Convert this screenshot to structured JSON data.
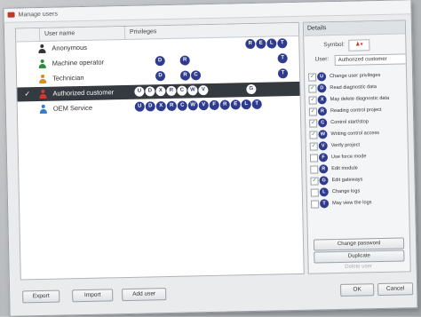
{
  "window": {
    "title": "Manage users"
  },
  "grid": {
    "header": {
      "user_name": "User name",
      "privileges": "Privileges"
    },
    "rows": [
      {
        "name": "Anonymous",
        "icon": "user-black-icon",
        "checked": false,
        "selected": false,
        "privileges": [
          "R",
          "E",
          "L",
          "T"
        ]
      },
      {
        "name": "Machine operator",
        "icon": "user-green-icon",
        "checked": false,
        "selected": false,
        "privileges": [
          "D",
          "R",
          "T"
        ]
      },
      {
        "name": "Technician",
        "icon": "user-orange-icon",
        "checked": false,
        "selected": false,
        "privileges": [
          "D",
          "R",
          "C",
          "T"
        ]
      },
      {
        "name": "Authorized customer",
        "icon": "user-red-icon",
        "checked": true,
        "selected": true,
        "privileges": [
          "U",
          "D",
          "X",
          "R",
          "C",
          "W",
          "V",
          "G"
        ]
      },
      {
        "name": "OEM Service",
        "icon": "user-blue-icon",
        "checked": false,
        "selected": false,
        "privileges": [
          "U",
          "D",
          "X",
          "R",
          "C",
          "W",
          "V",
          "F",
          "R",
          "E",
          "L",
          "T"
        ]
      }
    ]
  },
  "details": {
    "title": "Details",
    "symbol_label": "Symbol:",
    "symbol_value": "▾",
    "user_label": "User:",
    "user_value": "Authorized customer",
    "privileges": [
      {
        "letter": "U",
        "text": "Change user privileges",
        "checked": true
      },
      {
        "letter": "D",
        "text": "Read diagnostic data",
        "checked": true
      },
      {
        "letter": "X",
        "text": "May delete diagnostic data",
        "checked": true
      },
      {
        "letter": "R",
        "text": "Reading control project",
        "checked": true
      },
      {
        "letter": "C",
        "text": "Control start/stop",
        "checked": true
      },
      {
        "letter": "W",
        "text": "Writing control access",
        "checked": true
      },
      {
        "letter": "V",
        "text": "Verify project",
        "checked": true
      },
      {
        "letter": "F",
        "text": "Use force mode",
        "checked": false
      },
      {
        "letter": "R",
        "text": "Edit module",
        "checked": false
      },
      {
        "letter": "G",
        "text": "Edit gateways",
        "checked": true
      },
      {
        "letter": "L",
        "text": "Change logs",
        "checked": false
      },
      {
        "letter": "T",
        "text": "May view the logs",
        "checked": false
      }
    ],
    "buttons": {
      "change_password": "Change password",
      "duplicate": "Duplicate",
      "delete_user": "Delete user"
    }
  },
  "footer": {
    "export": "Export",
    "import": "Import",
    "add_user": "Add user",
    "ok": "OK",
    "cancel": "Cancel"
  },
  "colors": {
    "badge": "#2f3b8f",
    "selected_row": "#343a40"
  }
}
